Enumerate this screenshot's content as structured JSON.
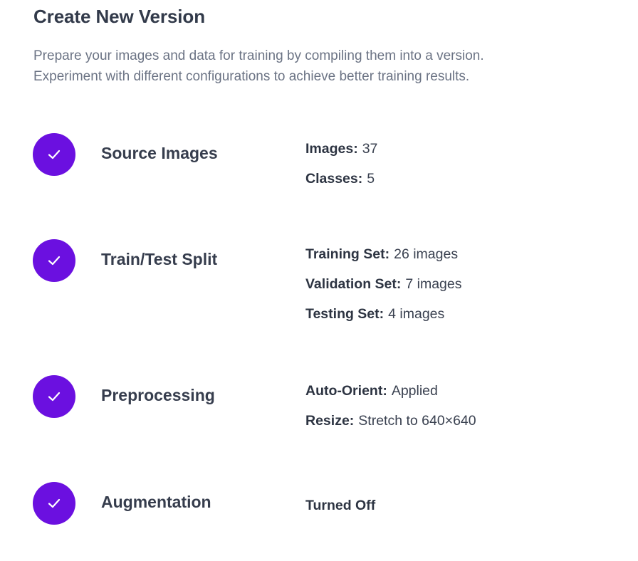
{
  "header": {
    "title": "Create New Version",
    "description_line1": "Prepare your images and data for training by compiling them into a version.",
    "description_line2": "Experiment with different configurations to achieve better training results."
  },
  "accent_color": "#6b10e0",
  "steps": [
    {
      "title": "Source Images",
      "status_icon": "check-icon",
      "details": [
        {
          "key": "Images:",
          "value": "37"
        },
        {
          "key": "Classes:",
          "value": "5"
        }
      ]
    },
    {
      "title": "Train/Test Split",
      "status_icon": "check-icon",
      "details": [
        {
          "key": "Training Set:",
          "value": "26 images"
        },
        {
          "key": "Validation Set:",
          "value": "7 images"
        },
        {
          "key": "Testing Set:",
          "value": "4 images"
        }
      ]
    },
    {
      "title": "Preprocessing",
      "status_icon": "check-icon",
      "details": [
        {
          "key": "Auto-Orient:",
          "value": "Applied"
        },
        {
          "key": "Resize:",
          "value": "Stretch to 640×640"
        }
      ]
    },
    {
      "title": "Augmentation",
      "status_icon": "check-icon",
      "status_text": "Turned Off"
    }
  ]
}
